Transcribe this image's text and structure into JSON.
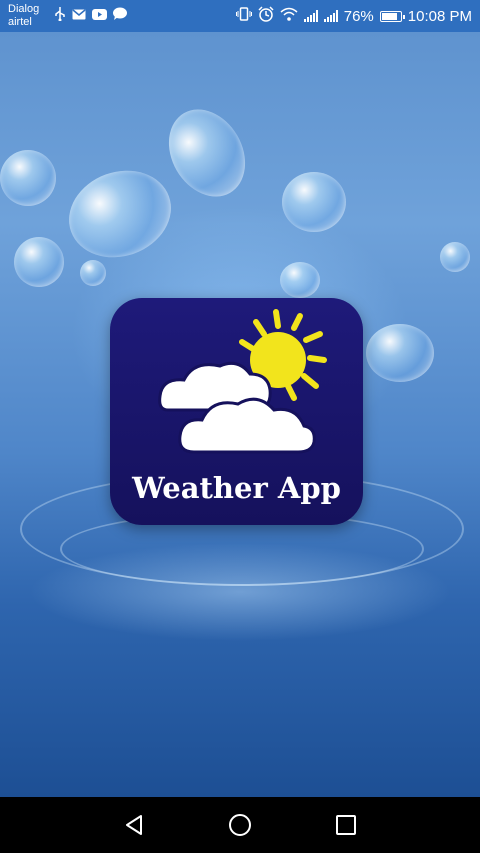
{
  "status_bar": {
    "carrier_line1": "Dialog",
    "carrier_line2": "airtel",
    "left_icons": [
      "usb-icon",
      "mail-icon",
      "youtube-icon",
      "chat-icon"
    ],
    "right_icons": [
      "vibrate-icon",
      "alarm-icon",
      "wifi-icon",
      "signal-icon",
      "signal-icon",
      "battery-icon"
    ],
    "battery": "76%",
    "time": "10:08 PM",
    "battery_level": 0.76,
    "color": "#2f6fbf"
  },
  "splash": {
    "app_title": "Weather App",
    "logo_bg": "#1e1a7a",
    "sun_color": "#f2e41c",
    "background_image": "water-splash"
  },
  "nav_bar": {
    "buttons": [
      "back-icon",
      "home-icon",
      "recents-icon"
    ]
  }
}
